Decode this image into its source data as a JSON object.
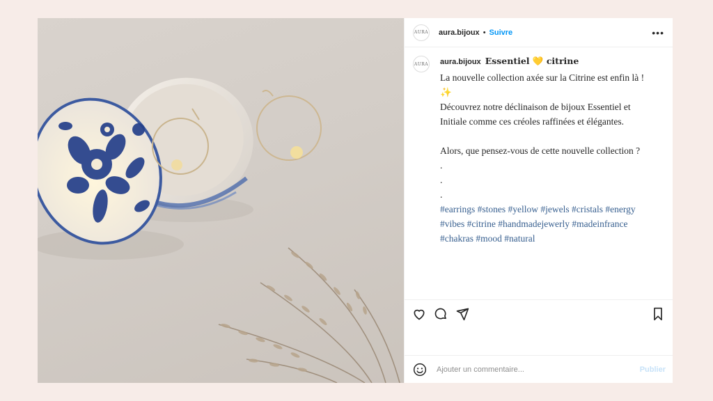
{
  "post": {
    "username": "aura.bijoux",
    "avatar_text": "AURA",
    "follow_label": "Suivre",
    "separator": "•",
    "more_label": "•••",
    "image_alt_desc": "",
    "caption": {
      "title": "Essentiel 💛 citrine",
      "lines": [
        "La nouvelle collection axée sur la Citrine est enfin là ! ✨",
        "Découvrez notre déclinaison de bijoux Essentiel et Initiale comme ces créoles raffinées et élégantes.",
        "",
        "Alors, que pensez-vous de cette nouvelle collection ?",
        ".",
        ".",
        "."
      ],
      "hashtags": [
        "#earrings",
        "#stones",
        "#yellow",
        "#jewels",
        "#cristals",
        "#energy",
        "#vibes",
        "#citrine",
        "#handmadejewerly",
        "#madeinfrance",
        "#chakras",
        "#mood",
        "#natural"
      ]
    },
    "comment": {
      "placeholder": "Ajouter un commentaire...",
      "post_label": "Publier"
    },
    "icons": {
      "like": "heart-icon",
      "comment": "comment-icon",
      "share": "share-icon",
      "save": "bookmark-icon",
      "emoji": "emoji-icon"
    },
    "colors": {
      "background": "#f7ece8",
      "follow": "#0095f6",
      "hashtag": "#375f8f",
      "publish_disabled": "#c7e2f8"
    }
  }
}
